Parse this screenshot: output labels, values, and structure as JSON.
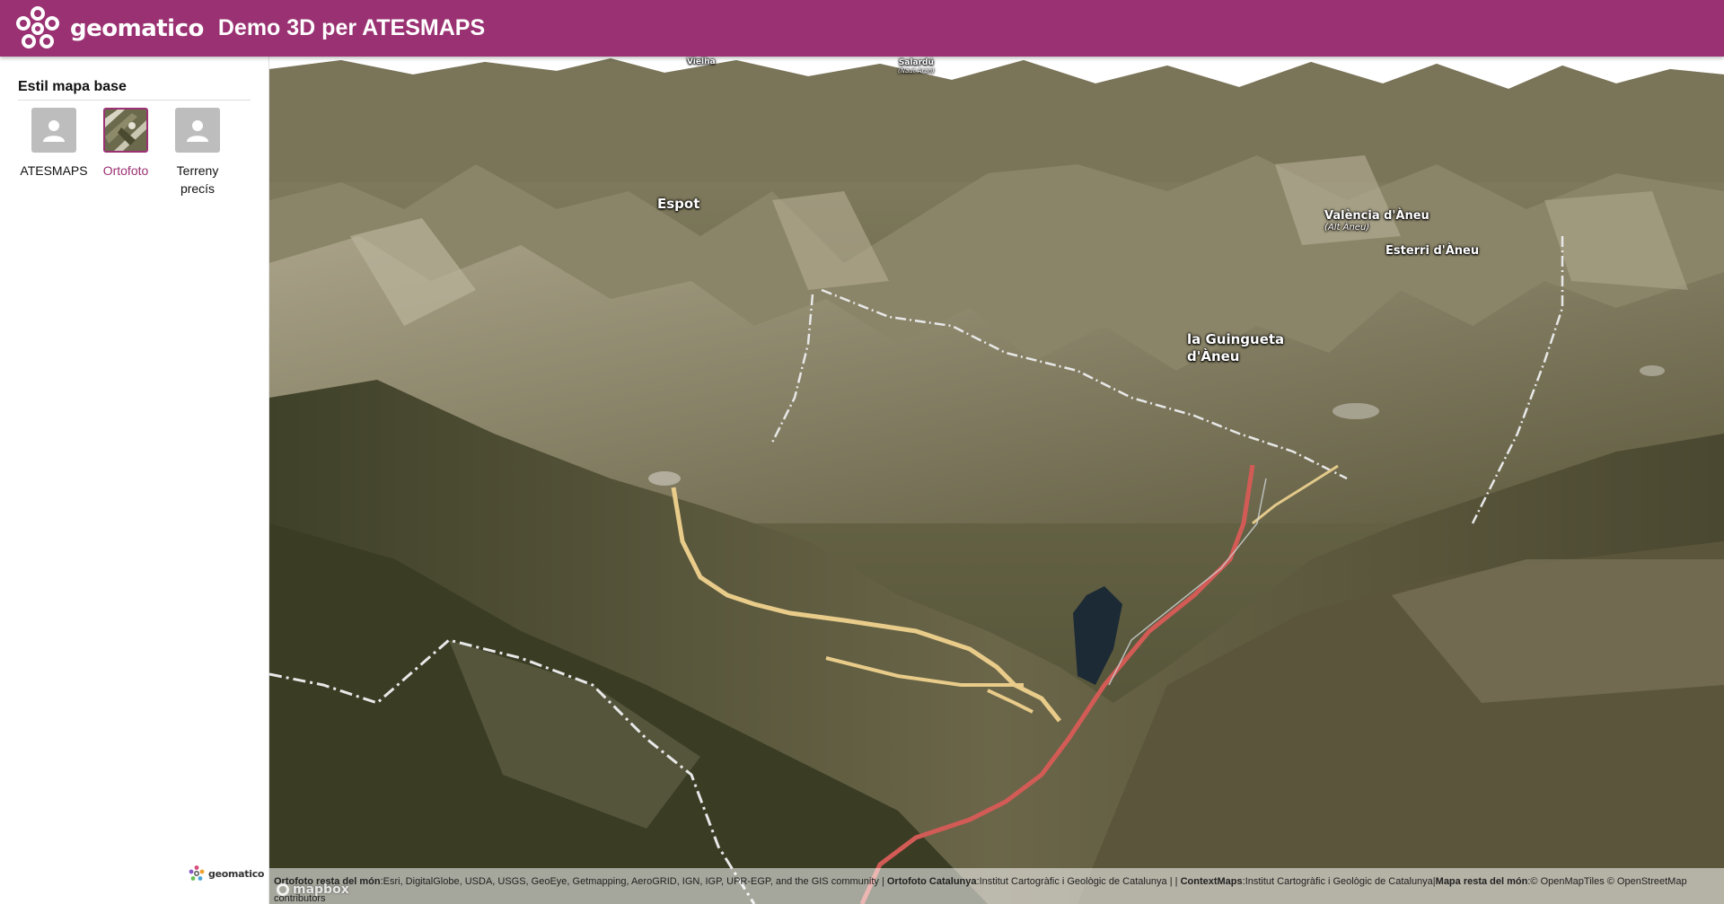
{
  "header": {
    "brand": "geomatico",
    "title": "Demo 3D per ATESMAPS",
    "color": "#9a3172"
  },
  "sidebar": {
    "panel_title": "Estil mapa base",
    "styles": [
      {
        "label": "ATESMAPS",
        "icon": "user-placeholder-icon",
        "selected": false
      },
      {
        "label": "Ortofoto",
        "icon": "orthophoto-thumbnail",
        "selected": true
      },
      {
        "label": "Terreny precís",
        "icon": "user-placeholder-icon",
        "selected": false
      }
    ],
    "footer_brand": "geomatico"
  },
  "map": {
    "places": [
      {
        "name": "Vielha"
      },
      {
        "name": "Salardú",
        "sub": "(Naut Aran)"
      },
      {
        "name": "Espot"
      },
      {
        "name": "València d'Àneu",
        "sub": "(Alt Àneu)"
      },
      {
        "name": "Esterri d'Àneu"
      },
      {
        "name": "la Guingueta d'Àneu"
      }
    ],
    "attribution": {
      "ortofoto_resta_label": "Ortofoto resta del món",
      "ortofoto_resta_text": "Esri, DigitalGlobe, USDA, USGS, GeoEye, Getmapping, AeroGRID, IGN, IGP, UPR-EGP, and the GIS community",
      "ortofoto_cat_label": "Ortofoto Catalunya",
      "ortofoto_cat_text": "Institut Cartogràfic i Geològic de Catalunya",
      "context_label": "ContextMaps",
      "context_text": "Institut Cartogràfic i Geològic de Catalunya",
      "mapa_resta_label": "Mapa resta del món",
      "mapa_resta_text": "© OpenMapTiles © OpenStreetMap contributors"
    },
    "mapbox_label": "mapbox"
  }
}
